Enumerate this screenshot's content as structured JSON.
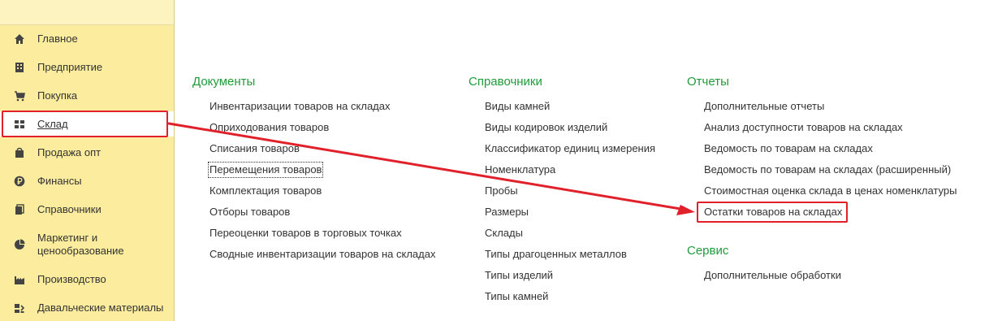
{
  "sidebar": {
    "items": [
      {
        "label": "Главное",
        "icon": "home-icon"
      },
      {
        "label": "Предприятие",
        "icon": "building-icon"
      },
      {
        "label": "Покупка",
        "icon": "cart-icon"
      },
      {
        "label": "Склад",
        "icon": "grid-icon",
        "active": true
      },
      {
        "label": "Продажа опт",
        "icon": "bag-icon"
      },
      {
        "label": "Финансы",
        "icon": "ruble-icon"
      },
      {
        "label": "Справочники",
        "icon": "books-icon"
      },
      {
        "label": "Маркетинг и",
        "label2": "ценообразование",
        "icon": "pie-chart-icon"
      },
      {
        "label": "Производство",
        "icon": "factory-icon"
      },
      {
        "label": "Давальческие материалы",
        "icon": "materials-icon"
      }
    ]
  },
  "sections": {
    "documents": {
      "title": "Документы",
      "items": [
        "Инвентаризации товаров на складах",
        "Оприходования товаров",
        "Списания товаров",
        "Перемещения товаров",
        "Комплектация товаров",
        "Отборы товаров",
        "Переоценки товаров в торговых точках",
        "Сводные инвентаризации товаров на складах"
      ]
    },
    "catalogs": {
      "title": "Справочники",
      "items": [
        "Виды камней",
        "Виды кодировок изделий",
        "Классификатор единиц измерения",
        "Номенклатура",
        "Пробы",
        "Размеры",
        "Склады",
        "Типы драгоценных металлов",
        "Типы изделий",
        "Типы камней"
      ]
    },
    "reports": {
      "title": "Отчеты",
      "items": [
        "Дополнительные отчеты",
        "Анализ доступности товаров на складах",
        "Ведомость по товарам на складах",
        "Ведомость по товарам на складах (расширенный)",
        "Стоимостная оценка склада в ценах номенклатуры",
        "Остатки товаров на складах"
      ]
    },
    "service": {
      "title": "Сервис",
      "items": [
        "Дополнительные обработки"
      ]
    }
  },
  "colors": {
    "sidebar_bg": "#fbec9e",
    "section_title": "#1f9b3a",
    "annotation_red": "#e0202a"
  }
}
